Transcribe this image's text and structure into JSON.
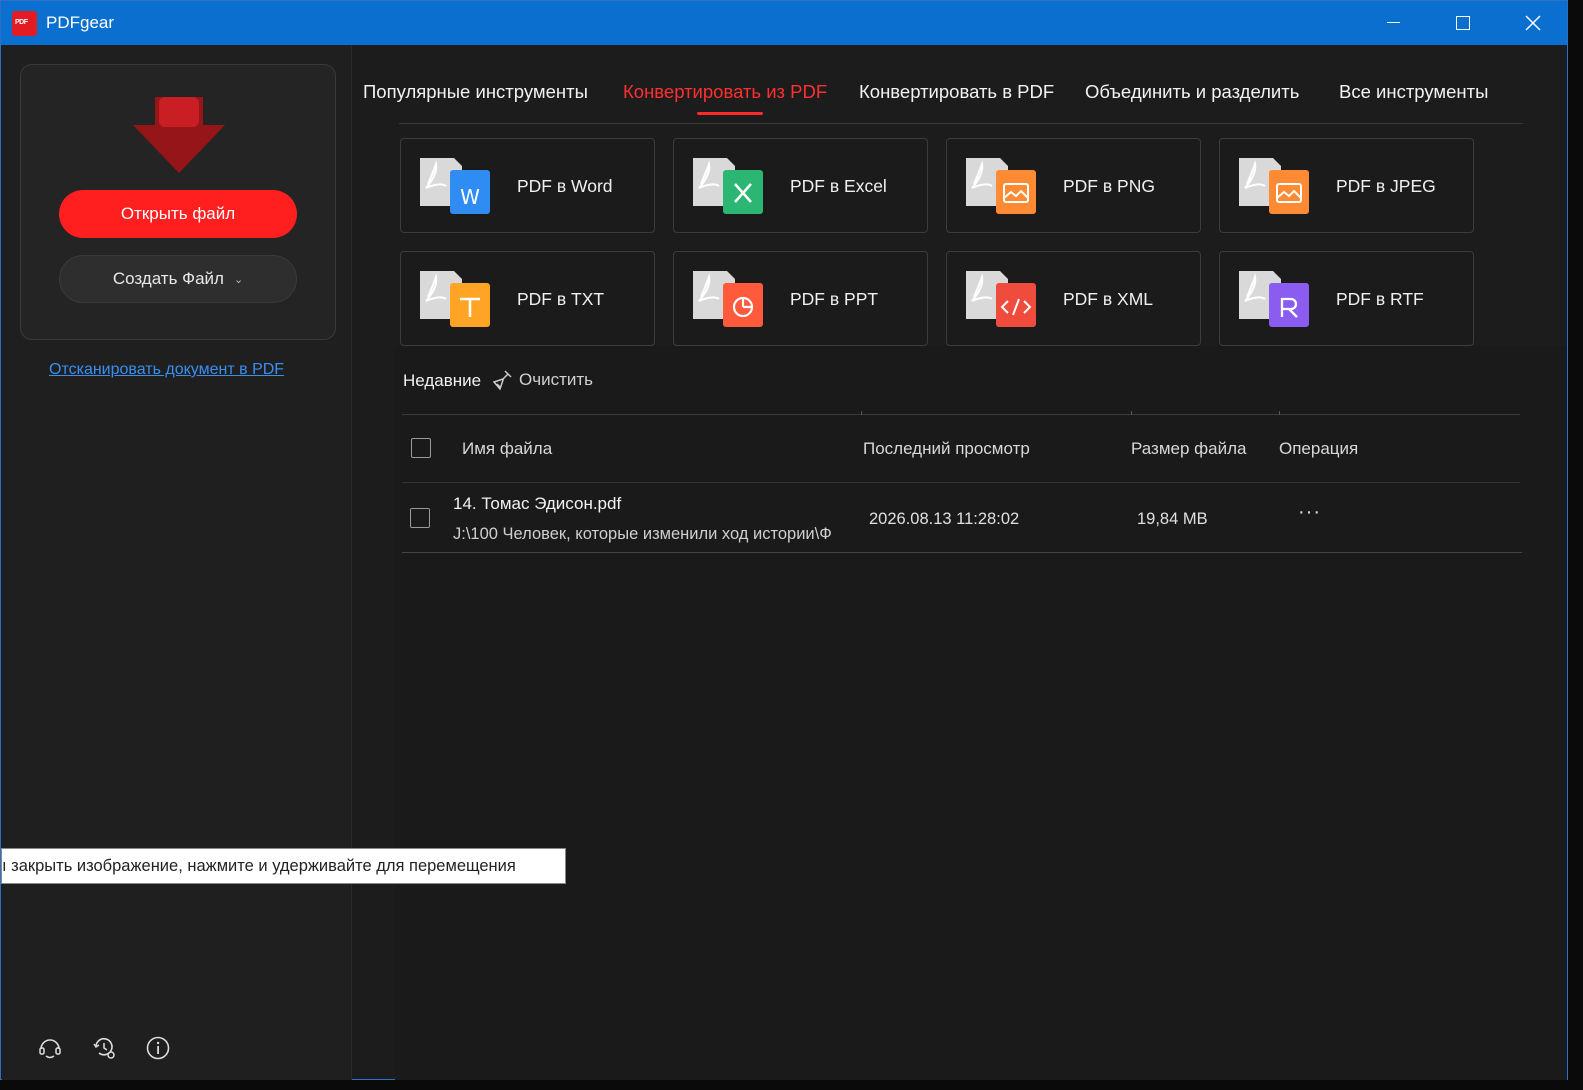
{
  "app": {
    "title": "PDFgear",
    "logo_text": "PDF"
  },
  "sidebar": {
    "open_button": "Открыть файл",
    "create_button": "Создать Файл",
    "scan_link": "Отсканировать документ в PDF"
  },
  "tabs": [
    {
      "label": "Популярные инструменты",
      "active": false
    },
    {
      "label": "Конвертировать из PDF",
      "active": true
    },
    {
      "label": "Конвертировать в PDF",
      "active": false
    },
    {
      "label": "Объединить и разделить",
      "active": false
    },
    {
      "label": "Все инструменты",
      "active": false
    }
  ],
  "tools": [
    {
      "label": "PDF в Word",
      "icon": "word-icon",
      "color": "#2f8cf3"
    },
    {
      "label": "PDF в Excel",
      "icon": "excel-icon",
      "color": "#2bb673"
    },
    {
      "label": "PDF в PNG",
      "icon": "png-icon",
      "color": "#ff8a34"
    },
    {
      "label": "PDF в JPEG",
      "icon": "jpeg-icon",
      "color": "#ff8a34"
    },
    {
      "label": "PDF в TXT",
      "icon": "txt-icon",
      "color": "#ffa425"
    },
    {
      "label": "PDF в PPT",
      "icon": "ppt-icon",
      "color": "#ff5a3c"
    },
    {
      "label": "PDF в XML",
      "icon": "xml-icon",
      "color": "#f04c3e"
    },
    {
      "label": "PDF в RTF",
      "icon": "rtf-icon",
      "color": "#8b5cf0"
    }
  ],
  "recent": {
    "title": "Недавние",
    "clear_label": "Очистить",
    "columns": [
      "Имя файла",
      "Последний просмотр",
      "Размер файла",
      "Операция"
    ],
    "rows": [
      {
        "name": "14. Томас Эдисон.pdf",
        "path": "J:\\100 Человек, которые изменили ход истории\\Ф",
        "last_viewed": "2026.08.13 11:28:02",
        "size": "19,84 MB",
        "operation": "···"
      }
    ]
  },
  "tooltip": "ı закрыть изображение, нажмите и удерживайте для перемещения",
  "colors": {
    "accent": "#ff2a2a",
    "titlebar": "#0b6fd0",
    "link": "#3a8ff0",
    "background": "#1c1c1c"
  }
}
